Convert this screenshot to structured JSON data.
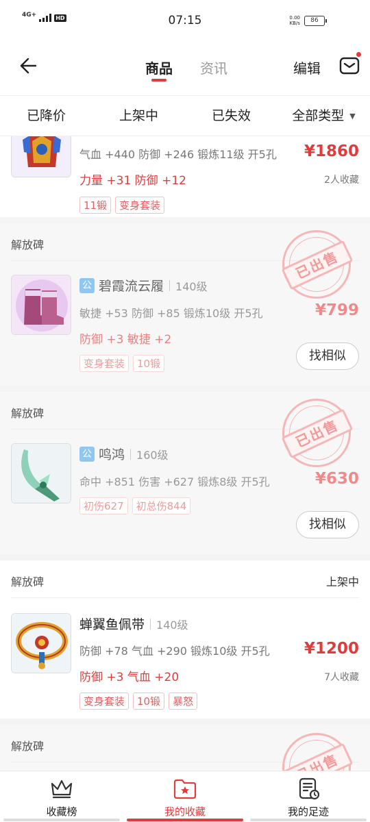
{
  "status_bar": {
    "network": "4G+",
    "hd": "HD",
    "time": "07:15",
    "speed_value": "0.00",
    "speed_unit": "KB/s",
    "battery": "86"
  },
  "nav": {
    "tabs": [
      {
        "label": "商品",
        "active": true
      },
      {
        "label": "资讯",
        "active": false
      }
    ],
    "edit_label": "编辑",
    "accent_color": "#e03c3c"
  },
  "filters": [
    {
      "label": "已降价"
    },
    {
      "label": "上架中"
    },
    {
      "label": "已失效"
    },
    {
      "label": "全部类型",
      "caret": "▼"
    }
  ],
  "cards": [
    {
      "server": "",
      "status": "",
      "name": "",
      "level": "",
      "stats": "气血 +440 防御 +246 锻炼11级 开5孔",
      "bonus": "力量 +31 防御 +12",
      "tags": [
        "11锻",
        "变身套装"
      ],
      "price": "¥1860",
      "favs": "2人收藏",
      "sold": false
    },
    {
      "server": "解放碑",
      "status": "",
      "gong": "公",
      "name": "碧霞流云履",
      "level": "140级",
      "stats": "敏捷 +53 防御 +85 锻炼10级 开5孔",
      "bonus": "防御 +3 敏捷 +2",
      "tags": [
        "变身套装",
        "10锻"
      ],
      "price": "¥799",
      "similar": "找相似",
      "stamp": "已出售",
      "sold": true
    },
    {
      "server": "解放碑",
      "status": "",
      "gong": "公",
      "name": "鸣鸿",
      "level": "160级",
      "stats": "命中 +851 伤害 +627 锻炼8级 开5孔",
      "bonus": "",
      "tags": [
        "初伤627",
        "初总伤844"
      ],
      "price": "¥630",
      "similar": "找相似",
      "stamp": "已出售",
      "sold": true
    },
    {
      "server": "解放碑",
      "status": "上架中",
      "name": "蝉翼鱼佩带",
      "level": "140级",
      "stats": "防御 +78 气血 +290 锻炼10级 开5孔",
      "bonus": "防御 +3 气血 +20",
      "tags": [
        "变身套装",
        "10锻",
        "暴怒"
      ],
      "price": "¥1200",
      "favs": "7人收藏",
      "sold": false
    },
    {
      "server": "解放碑",
      "status": "",
      "stamp": "已出售",
      "sold": true
    }
  ],
  "bottom_nav": [
    {
      "label": "收藏榜",
      "icon": "crown-icon",
      "active": false
    },
    {
      "label": "我的收藏",
      "icon": "star-folder-icon",
      "active": true
    },
    {
      "label": "我的足迹",
      "icon": "history-doc-icon",
      "active": false
    }
  ]
}
